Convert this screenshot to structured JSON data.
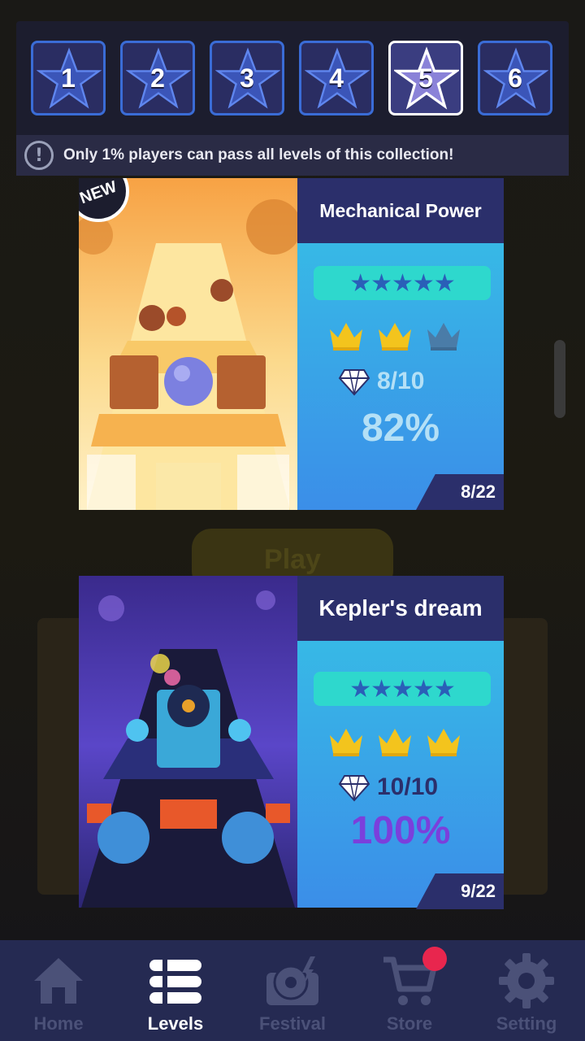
{
  "collection": {
    "tabs": [
      {
        "label": "1",
        "active": false
      },
      {
        "label": "2",
        "active": false
      },
      {
        "label": "3",
        "active": false
      },
      {
        "label": "4",
        "active": false
      },
      {
        "label": "5",
        "active": true
      },
      {
        "label": "6",
        "active": false
      }
    ],
    "notice": "Only 1%  players can pass all levels of this collection!",
    "notice_icon": "exclamation-icon"
  },
  "background": {
    "play_label": "Play"
  },
  "songs": [
    {
      "title": "Mechanical Power",
      "badge": "NEW",
      "stars": "★★★★★",
      "crowns_earned": 2,
      "crowns_total": 3,
      "gems": "8/10",
      "percent": "82%",
      "index": "8/22"
    },
    {
      "title": "Kepler's dream",
      "stars": "★★★★★",
      "crowns_earned": 3,
      "crowns_total": 3,
      "gems": "10/10",
      "percent": "100%",
      "index": "9/22"
    }
  ],
  "nav": {
    "items": [
      {
        "label": "Home",
        "icon": "home-icon"
      },
      {
        "label": "Levels",
        "icon": "list-icon"
      },
      {
        "label": "Festival",
        "icon": "turntable-icon"
      },
      {
        "label": "Store",
        "icon": "cart-icon"
      },
      {
        "label": "Setting",
        "icon": "gear-icon"
      }
    ],
    "active": "Levels"
  },
  "colors": {
    "crown_gold": "#f3c41d",
    "crown_empty": "#4a7ca8",
    "percent_partial": "#b4e0f6",
    "percent_full": "#7b3fdc",
    "nav_bg": "#252a52",
    "notification": "#e8264e"
  }
}
